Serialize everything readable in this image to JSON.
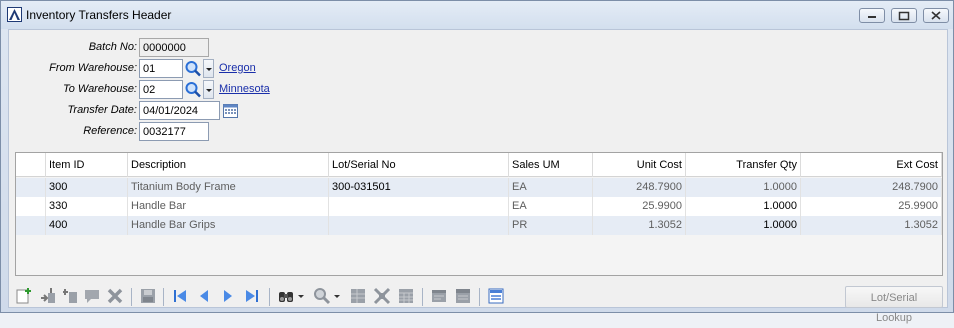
{
  "window": {
    "title": "Inventory Transfers Header"
  },
  "header": {
    "batch_no_label": "Batch No:",
    "batch_no": "0000000",
    "from_warehouse_label": "From Warehouse:",
    "from_warehouse": "01",
    "from_warehouse_name": "Oregon",
    "to_warehouse_label": "To Warehouse:",
    "to_warehouse": "02",
    "to_warehouse_name": "Minnesota",
    "transfer_date_label": "Transfer Date:",
    "transfer_date": "04/01/2024",
    "reference_label": "Reference:",
    "reference": "0032177"
  },
  "grid": {
    "columns": [
      "Item ID",
      "Description",
      "Lot/Serial No",
      "Sales UM",
      "Unit Cost",
      "Transfer Qty",
      "Ext Cost"
    ],
    "rows": [
      {
        "item_id": "300",
        "description": "Titanium Body Frame",
        "lot_serial": "300-031501",
        "sales_um": "EA",
        "unit_cost": "248.7900",
        "transfer_qty": "1.0000",
        "ext_cost": "248.7900"
      },
      {
        "item_id": "330",
        "description": "Handle Bar",
        "lot_serial": "",
        "sales_um": "EA",
        "unit_cost": "25.9900",
        "transfer_qty": "1.0000",
        "ext_cost": "25.9900"
      },
      {
        "item_id": "400",
        "description": "Handle Bar Grips",
        "lot_serial": "",
        "sales_um": "PR",
        "unit_cost": "1.3052",
        "transfer_qty": "1.0000",
        "ext_cost": "1.3052"
      }
    ]
  },
  "toolbar": {
    "lot_serial_lookup_label": "Lot/Serial Lookup",
    "icons": [
      "new-record-icon",
      "insert-row-icon",
      "insert-above-icon",
      "memo-icon",
      "delete-icon",
      "save-icon",
      "first-record-icon",
      "previous-record-icon",
      "next-record-icon",
      "last-record-icon",
      "find-icon",
      "zoom-icon",
      "grid-view-icon",
      "expand-icon",
      "table-icon",
      "notes-icon",
      "list-icon",
      "customize-icon"
    ]
  },
  "colors": {
    "title_bar": "#d8e3f0",
    "grid_alt_row": "#e6ecf5",
    "link": "#1a2faa",
    "lookup_icon_blue": "#2b6fd6"
  }
}
